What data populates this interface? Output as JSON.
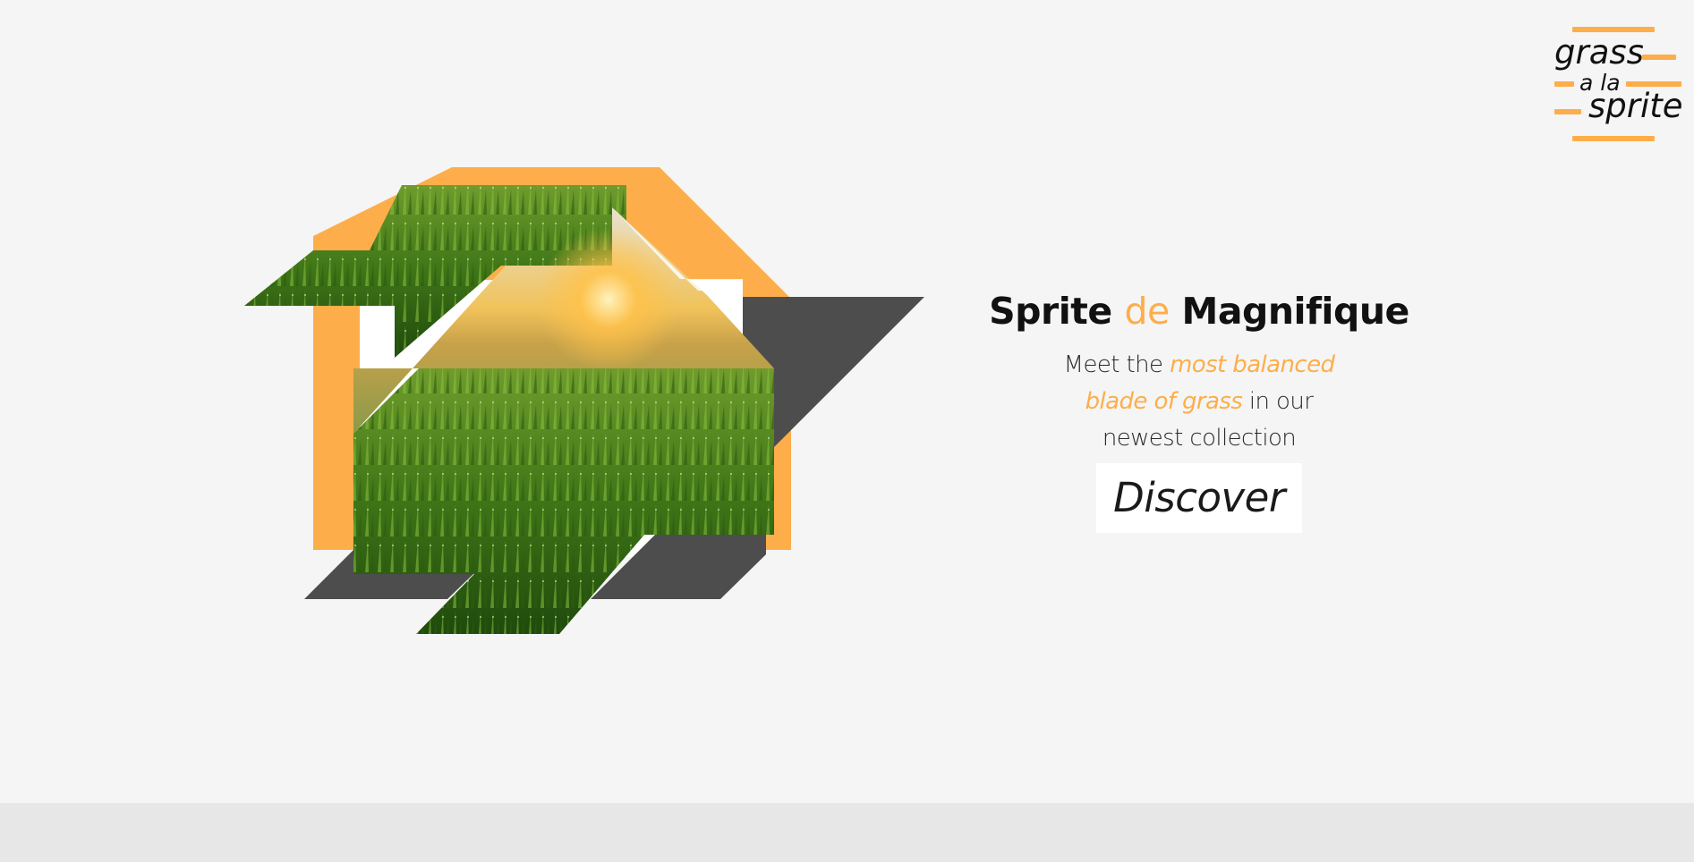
{
  "logo": {
    "line1": "grass",
    "line2": "a la",
    "line3": "sprite"
  },
  "hero": {
    "title_part1": "Sprite",
    "title_accent": "de",
    "title_part2": "Magnifique",
    "tagline_part1": "Meet the",
    "tagline_highlight1": "most balanced",
    "tagline_highlight2": "blade of grass",
    "tagline_part2": "in our",
    "tagline_part3": "newest collection",
    "cta_label": "Discover"
  },
  "colors": {
    "accent": "#fdae4a",
    "dark_gray": "#4d4d4d",
    "background": "#f5f5f5",
    "footer": "#e7e7e7"
  }
}
